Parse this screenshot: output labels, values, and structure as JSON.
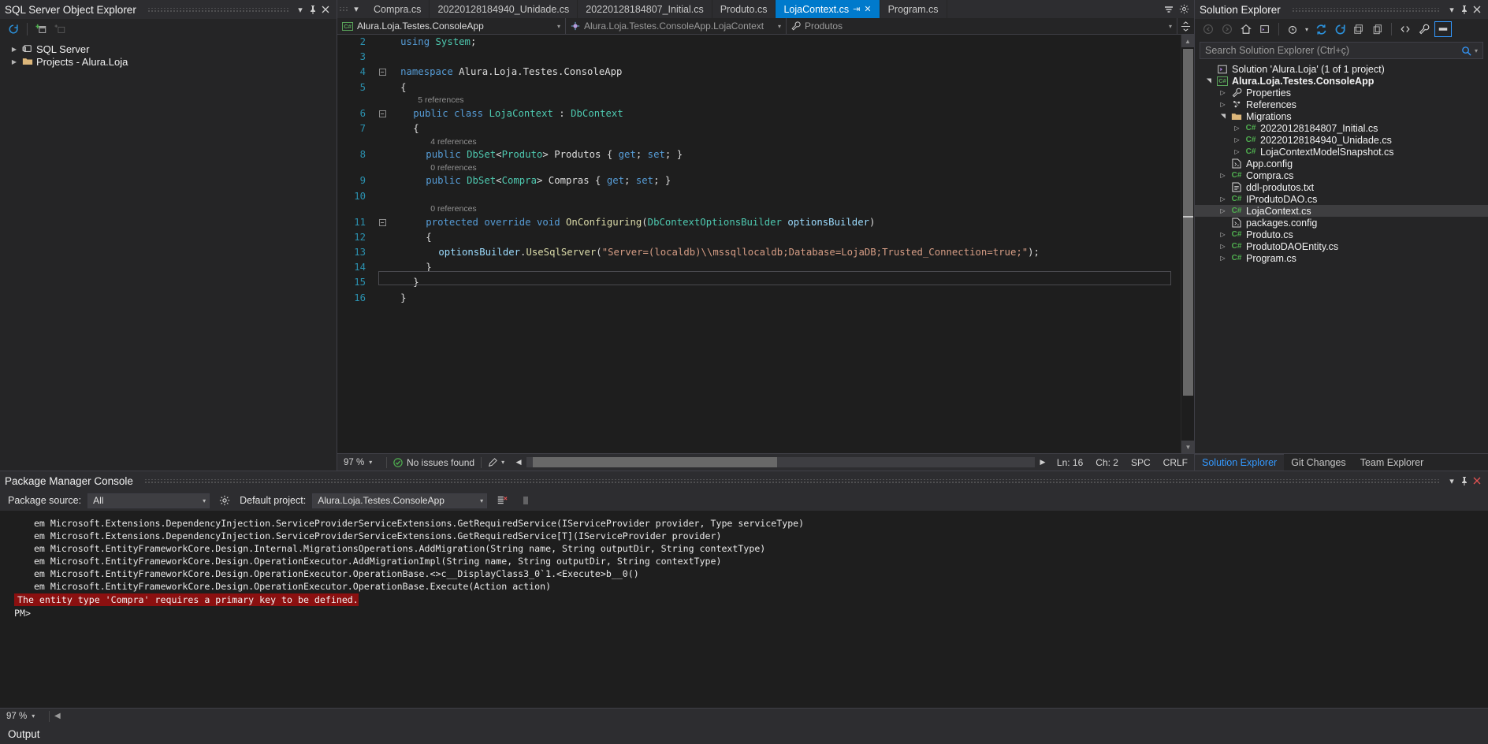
{
  "sqlServerExplorer": {
    "title": "SQL Server Object Explorer",
    "toolbar": [
      "refresh-icon",
      "add-server-icon",
      "add-query-icon"
    ],
    "titlebar_buttons": [
      "chevron-down-icon",
      "pin-icon",
      "close-icon"
    ],
    "tree": [
      {
        "label": "SQL Server",
        "icon": "server-icon",
        "expander": "collapsed"
      },
      {
        "label": "Projects - Alura.Loja",
        "icon": "folder-icon",
        "expander": "collapsed"
      }
    ]
  },
  "editor": {
    "tabs": [
      {
        "label": "Compra.cs",
        "active": false
      },
      {
        "label": "20220128184940_Unidade.cs",
        "active": false
      },
      {
        "label": "20220128184807_Initial.cs",
        "active": false
      },
      {
        "label": "Produto.cs",
        "active": false
      },
      {
        "label": "LojaContext.cs",
        "active": true,
        "pinned": true,
        "closable": true
      },
      {
        "label": "Program.cs",
        "active": false
      }
    ],
    "tabstrip_buttons": [
      "chevron-down-icon",
      "gear-icon"
    ],
    "navbar": {
      "project": "Alura.Loja.Testes.ConsoleApp",
      "type": "Alura.Loja.Testes.ConsoleApp.LojaContext",
      "member": "Produtos"
    },
    "code_lines": [
      {
        "n": "2",
        "gutter": "none",
        "fold": "",
        "indent": 1,
        "tokens": [
          [
            "kw",
            "using"
          ],
          [
            "pun",
            " "
          ],
          [
            "typ",
            "System"
          ],
          [
            "pun",
            ";"
          ]
        ]
      },
      {
        "n": "3",
        "gutter": "none",
        "fold": "",
        "indent": 1,
        "tokens": []
      },
      {
        "n": "4",
        "gutter": "none",
        "fold": "minus",
        "indent": 1,
        "tokens": [
          [
            "kw",
            "namespace"
          ],
          [
            "pun",
            " Alura.Loja.Testes.ConsoleApp"
          ]
        ]
      },
      {
        "n": "5",
        "gutter": "none",
        "fold": "",
        "indent": 1,
        "tokens": [
          [
            "pun",
            "{"
          ]
        ]
      },
      {
        "ref": "5 references",
        "indent": 2
      },
      {
        "n": "6",
        "gutter": "none",
        "fold": "minus",
        "indent": 2,
        "tokens": [
          [
            "kw",
            "public"
          ],
          [
            "pun",
            " "
          ],
          [
            "kw",
            "class"
          ],
          [
            "pun",
            " "
          ],
          [
            "cls",
            "LojaContext"
          ],
          [
            "pun",
            " : "
          ],
          [
            "typ",
            "DbContext"
          ]
        ]
      },
      {
        "n": "7",
        "gutter": "none",
        "fold": "",
        "indent": 2,
        "tokens": [
          [
            "pun",
            "{"
          ]
        ]
      },
      {
        "ref": "4 references",
        "indent": 3,
        "gutter": "saved"
      },
      {
        "n": "8",
        "gutter": "saved",
        "fold": "",
        "indent": 3,
        "tokens": [
          [
            "kw",
            "public"
          ],
          [
            "pun",
            " "
          ],
          [
            "typ",
            "DbSet"
          ],
          [
            "pun",
            "<"
          ],
          [
            "typ",
            "Produto"
          ],
          [
            "pun",
            "> Produtos { "
          ],
          [
            "kw",
            "get"
          ],
          [
            "pun",
            "; "
          ],
          [
            "kw",
            "set"
          ],
          [
            "pun",
            "; }"
          ]
        ]
      },
      {
        "ref": "0 references",
        "indent": 3,
        "gutter": "saved"
      },
      {
        "n": "9",
        "gutter": "saved",
        "fold": "",
        "indent": 3,
        "tokens": [
          [
            "kw",
            "public"
          ],
          [
            "pun",
            " "
          ],
          [
            "typ",
            "DbSet"
          ],
          [
            "pun",
            "<"
          ],
          [
            "typ",
            "Compra"
          ],
          [
            "pun",
            "> Compras { "
          ],
          [
            "kw",
            "get"
          ],
          [
            "pun",
            "; "
          ],
          [
            "kw",
            "set"
          ],
          [
            "pun",
            "; }"
          ]
        ]
      },
      {
        "n": "10",
        "gutter": "none",
        "fold": "",
        "indent": 3,
        "tokens": []
      },
      {
        "ref": "0 references",
        "indent": 3
      },
      {
        "n": "11",
        "gutter": "none",
        "fold": "minus",
        "indent": 3,
        "tokens": [
          [
            "kw",
            "protected"
          ],
          [
            "pun",
            " "
          ],
          [
            "kw",
            "override"
          ],
          [
            "pun",
            " "
          ],
          [
            "kw",
            "void"
          ],
          [
            "pun",
            " "
          ],
          [
            "mth",
            "OnConfiguring"
          ],
          [
            "pun",
            "("
          ],
          [
            "typ",
            "DbContextOptionsBuilder"
          ],
          [
            "pun",
            " "
          ],
          [
            "ident",
            "optionsBuilder"
          ],
          [
            "pun",
            ")"
          ]
        ]
      },
      {
        "n": "12",
        "gutter": "none",
        "fold": "",
        "indent": 3,
        "tokens": [
          [
            "pun",
            "{"
          ]
        ]
      },
      {
        "n": "13",
        "gutter": "none",
        "fold": "",
        "indent": 4,
        "tokens": [
          [
            "ident",
            "optionsBuilder"
          ],
          [
            "pun",
            "."
          ],
          [
            "mth",
            "UseSqlServer"
          ],
          [
            "pun",
            "("
          ],
          [
            "str",
            "\"Server=(localdb)\\\\mssqllocaldb;Database=LojaDB;Trusted_Connection=true;\""
          ],
          [
            "pun",
            ");"
          ]
        ]
      },
      {
        "n": "14",
        "gutter": "none",
        "fold": "",
        "indent": 3,
        "tokens": [
          [
            "pun",
            "}"
          ]
        ]
      },
      {
        "n": "15",
        "gutter": "none",
        "fold": "",
        "indent": 2,
        "tokens": [
          [
            "pun",
            "}"
          ]
        ]
      },
      {
        "n": "16",
        "gutter": "none",
        "fold": "",
        "indent": 1,
        "tokens": [
          [
            "pun",
            "}"
          ]
        ],
        "caret": true
      }
    ],
    "status": {
      "zoom": "97 %",
      "issues": "No issues found",
      "line": "Ln: 16",
      "col": "Ch: 2",
      "spaces": "SPC",
      "lineending": "CRLF"
    }
  },
  "solutionExplorer": {
    "title": "Solution Explorer",
    "titlebar_buttons": [
      "chevron-down-icon",
      "pin-icon",
      "close-icon"
    ],
    "toolbar": [
      "back-icon",
      "forward-icon",
      "home-icon",
      "solution-icon",
      "pending-changes-icon",
      "sync-icon",
      "refresh-icon",
      "collapse-all-icon",
      "show-all-files-icon",
      "code-view-icon",
      "properties-icon",
      "preview-icon"
    ],
    "search": {
      "placeholder": "Search Solution Explorer (Ctrl+ç)",
      "value": ""
    },
    "tree": [
      {
        "depth": 0,
        "tri": "none",
        "icon": "vs-solution-icon",
        "label": "Solution 'Alura.Loja' (1 of 1 project)",
        "bold": false
      },
      {
        "depth": 0,
        "tri": "expanded",
        "icon": "csharp-project-icon",
        "label": "Alura.Loja.Testes.ConsoleApp",
        "bold": true
      },
      {
        "depth": 1,
        "tri": "collapsed",
        "icon": "wrench-icon",
        "label": "Properties",
        "bold": false
      },
      {
        "depth": 1,
        "tri": "collapsed",
        "icon": "references-icon",
        "label": "References",
        "bold": false
      },
      {
        "depth": 1,
        "tri": "expanded",
        "icon": "folder-icon",
        "label": "Migrations",
        "bold": false
      },
      {
        "depth": 2,
        "tri": "collapsed",
        "icon": "csharp-file-icon",
        "label": "20220128184807_Initial.cs",
        "bold": false
      },
      {
        "depth": 2,
        "tri": "collapsed",
        "icon": "csharp-file-icon",
        "label": "20220128184940_Unidade.cs",
        "bold": false
      },
      {
        "depth": 2,
        "tri": "collapsed",
        "icon": "csharp-file-icon",
        "label": "LojaContextModelSnapshot.cs",
        "bold": false
      },
      {
        "depth": 1,
        "tri": "none",
        "icon": "config-file-icon",
        "label": "App.config",
        "bold": false
      },
      {
        "depth": 1,
        "tri": "collapsed",
        "icon": "csharp-file-icon",
        "label": "Compra.cs",
        "bold": false
      },
      {
        "depth": 1,
        "tri": "none",
        "icon": "text-file-icon",
        "label": "ddl-produtos.txt",
        "bold": false
      },
      {
        "depth": 1,
        "tri": "collapsed",
        "icon": "csharp-file-icon",
        "label": "IProdutoDAO.cs",
        "bold": false
      },
      {
        "depth": 1,
        "tri": "collapsed",
        "icon": "csharp-file-icon",
        "label": "LojaContext.cs",
        "bold": false,
        "selected": true
      },
      {
        "depth": 1,
        "tri": "none",
        "icon": "config-file-icon",
        "label": "packages.config",
        "bold": false
      },
      {
        "depth": 1,
        "tri": "collapsed",
        "icon": "csharp-file-icon",
        "label": "Produto.cs",
        "bold": false
      },
      {
        "depth": 1,
        "tri": "collapsed",
        "icon": "csharp-file-icon",
        "label": "ProdutoDAOEntity.cs",
        "bold": false
      },
      {
        "depth": 1,
        "tri": "collapsed",
        "icon": "csharp-file-icon",
        "label": "Program.cs",
        "bold": false
      }
    ],
    "tabs": [
      {
        "label": "Solution Explorer",
        "active": true
      },
      {
        "label": "Git Changes",
        "active": false
      },
      {
        "label": "Team Explorer",
        "active": false
      }
    ]
  },
  "packageManagerConsole": {
    "title": "Package Manager Console",
    "titlebar_buttons": [
      "chevron-down-icon",
      "pin-icon",
      "close-icon"
    ],
    "packageSourceLabel": "Package source:",
    "packageSourceValue": "All",
    "defaultProjectLabel": "Default project:",
    "defaultProjectValue": "Alura.Loja.Testes.ConsoleApp",
    "toolbar_icons": [
      "settings-gear-icon",
      "clear-console-icon",
      "stop-icon"
    ],
    "output": [
      "   em Microsoft.Extensions.DependencyInjection.ServiceProviderServiceExtensions.GetRequiredService(IServiceProvider provider, Type serviceType)",
      "   em Microsoft.Extensions.DependencyInjection.ServiceProviderServiceExtensions.GetRequiredService[T](IServiceProvider provider)",
      "   em Microsoft.EntityFrameworkCore.Design.Internal.MigrationsOperations.AddMigration(String name, String outputDir, String contextType)",
      "   em Microsoft.EntityFrameworkCore.Design.OperationExecutor.AddMigrationImpl(String name, String outputDir, String contextType)",
      "   em Microsoft.EntityFrameworkCore.Design.OperationExecutor.OperationBase.<>c__DisplayClass3_0`1.<Execute>b__0()",
      "   em Microsoft.EntityFrameworkCore.Design.OperationExecutor.OperationBase.Execute(Action action)"
    ],
    "error": "The entity type 'Compra' requires a primary key to be defined.",
    "prompt": "PM>",
    "status_zoom": "97 %"
  },
  "outputPanel": {
    "title": "Output"
  },
  "colors": {
    "accent": "#007acc",
    "panel": "#252526",
    "chrome": "#2d2d30",
    "editorBg": "#1e1e1e",
    "error": "#8b1010",
    "savedGutter": "#4a8f3c",
    "linkBlue": "#3399ff"
  }
}
